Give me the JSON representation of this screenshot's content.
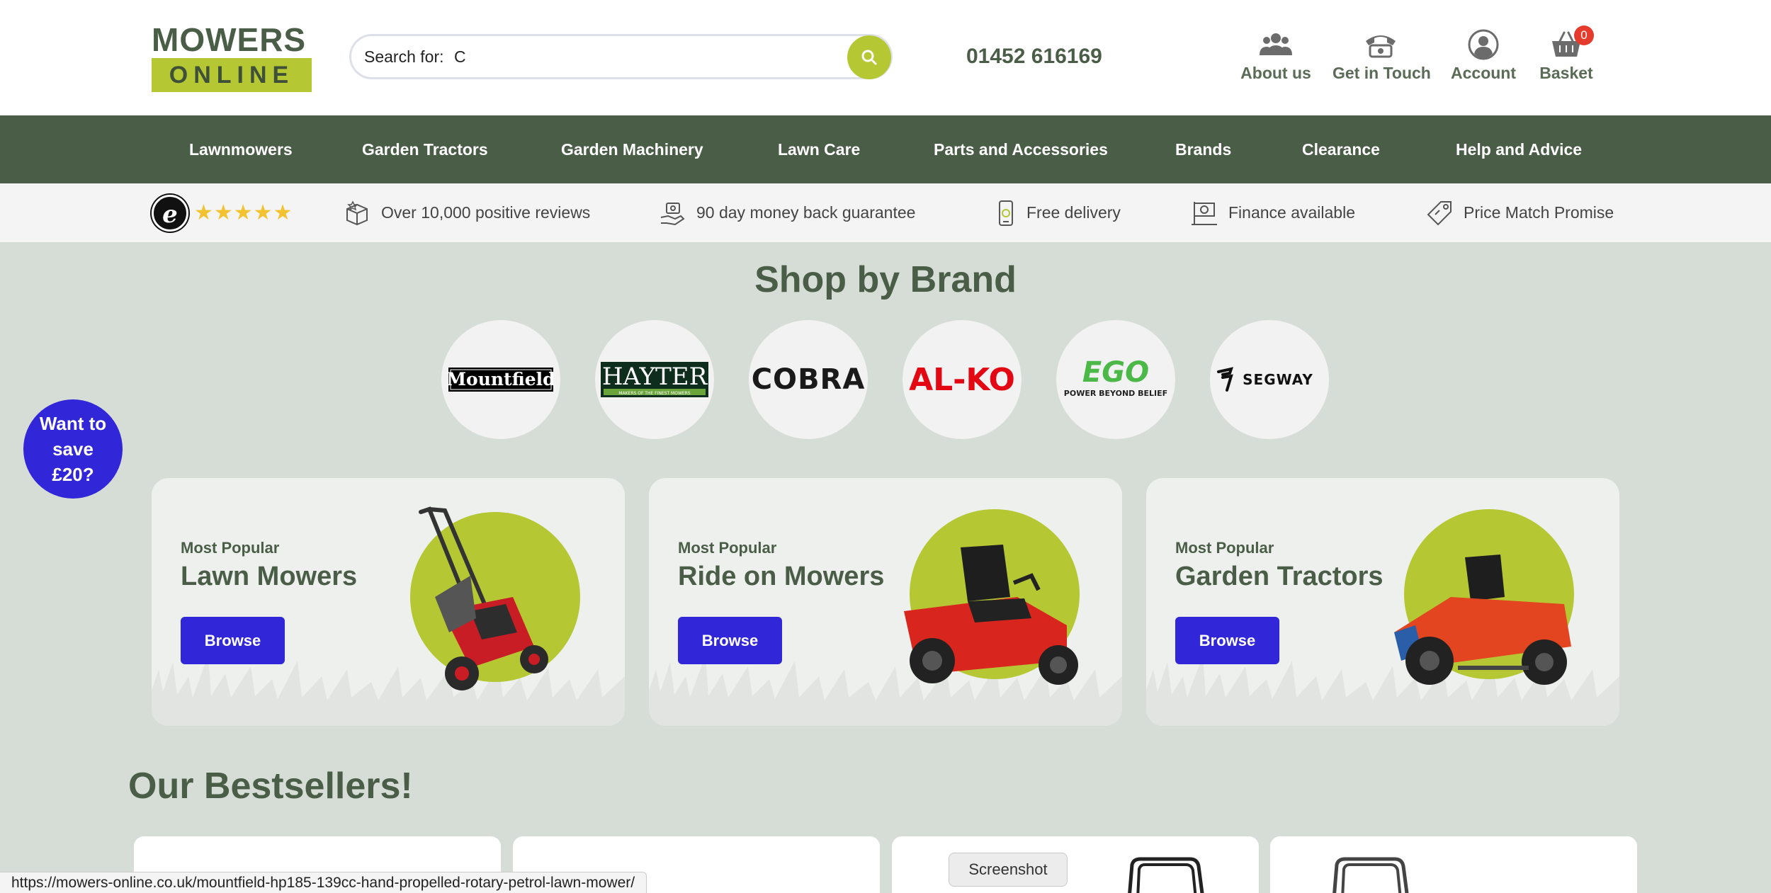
{
  "header": {
    "logo_top": "MOWERS",
    "logo_bottom": "ONLINE",
    "search": {
      "prefix": "Search for:",
      "value": "C"
    },
    "phone": "01452 616169",
    "links": [
      {
        "label": "About us",
        "icon": "group-icon"
      },
      {
        "label": "Get in Touch",
        "icon": "phone-icon"
      },
      {
        "label": "Account",
        "icon": "user-icon"
      },
      {
        "label": "Basket",
        "icon": "basket-icon",
        "badge": "0"
      }
    ]
  },
  "nav": {
    "items": [
      "Lawnmowers",
      "Garden Tractors",
      "Garden Machinery",
      "Lawn Care",
      "Parts and Accessories",
      "Brands",
      "Clearance",
      "Help and Advice"
    ]
  },
  "usp": {
    "trust_letter": "e",
    "stars": "★★★★★",
    "items": [
      "Over 10,000 positive reviews",
      "90 day money back guarantee",
      "Free delivery",
      "Finance available",
      "Price Match Promise"
    ]
  },
  "brands": {
    "title": "Shop by Brand",
    "items": [
      "Mountfield",
      "HAYTER",
      "COBRA",
      "AL-KO",
      "EGO",
      "SEGWAY"
    ],
    "hayter_tagline": "MAKERS OF THE FINEST MOWERS",
    "ego_tagline": "POWER BEYOND BELIEF"
  },
  "save_badge": "Want to save £20?",
  "categories": [
    {
      "kicker": "Most Popular",
      "title": "Lawn Mowers",
      "button": "Browse"
    },
    {
      "kicker": "Most Popular",
      "title": "Ride on Mowers",
      "button": "Browse"
    },
    {
      "kicker": "Most Popular",
      "title": "Garden Tractors",
      "button": "Browse"
    }
  ],
  "bestsellers": {
    "title": "Our Bestsellers!"
  },
  "status_url": "https://mowers-online.co.uk/mountfield-hp185-139cc-hand-propelled-rotary-petrol-lawn-mower/",
  "tooltip": "Screenshot",
  "colors": {
    "brand_green": "#4a5e47",
    "lime": "#b5c733",
    "blue": "#3226d9",
    "badge_red": "#e53b2c"
  }
}
